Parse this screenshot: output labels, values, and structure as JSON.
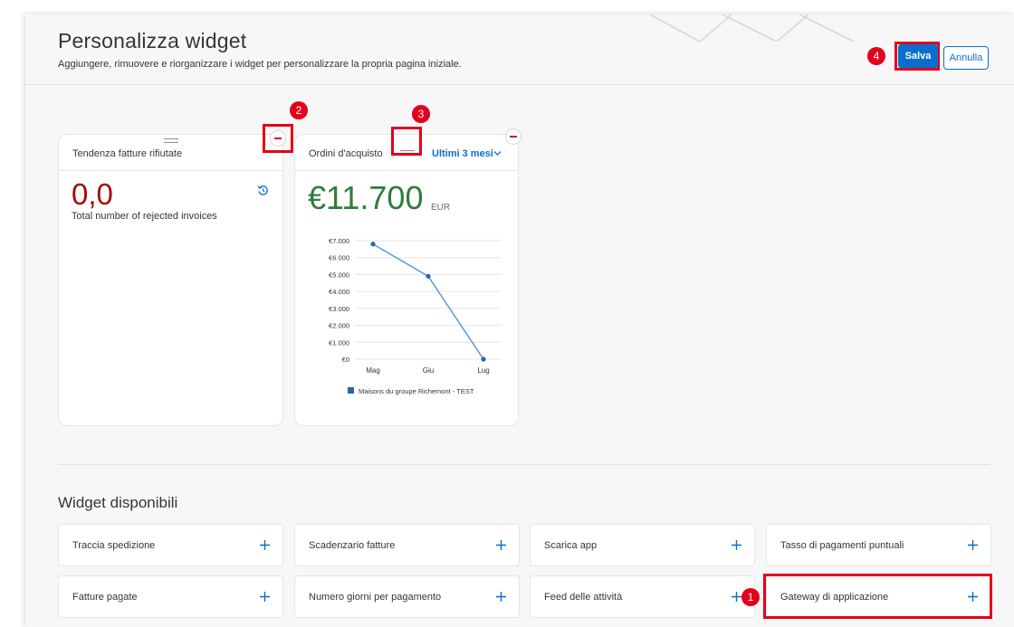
{
  "header": {
    "title": "Personalizza widget",
    "subtitle": "Aggiungere, rimuovere e riorganizzare i widget per personalizzare la propria pagina iniziale.",
    "save_label": "Salva",
    "cancel_label": "Annulla"
  },
  "callouts": [
    "1",
    "2",
    "3",
    "4"
  ],
  "widgets": {
    "rejected": {
      "title": "Tendenza fatture rifiutate",
      "value": "0,0",
      "description": "Total number of rejected invoices",
      "icon": "refresh-icon"
    },
    "orders": {
      "title": "Ordini d'acquisto",
      "period": "Ultimi 3 mesi",
      "value": "€11.700",
      "unit": "EUR"
    }
  },
  "chart_data": {
    "type": "line",
    "categories": [
      "Mag",
      "Giu",
      "Lug"
    ],
    "series": [
      {
        "name": "Maisons du groupe Richemont - TEST",
        "values": [
          6800,
          4900,
          0
        ],
        "color": "#5b9bd5"
      }
    ],
    "yticks": [
      "€7.000",
      "€6.000",
      "€5.000",
      "€4.000",
      "€3.000",
      "€2.000",
      "€1.000",
      "€0"
    ],
    "ylim": [
      0,
      7000
    ],
    "grid": true,
    "legend": "bottom"
  },
  "available": {
    "title": "Widget disponibili",
    "items": [
      "Traccia spedizione",
      "Scadenzario fatture",
      "Scarica app",
      "Tasso di pagamenti puntuali",
      "Fatture pagate",
      "Numero giorni per pagamento",
      "Feed delle attività",
      "Gateway di applicazione"
    ]
  },
  "colors": {
    "accent": "#0a6ed1",
    "callout": "#e3001b",
    "kpi_negative": "#aa0808",
    "kpi_positive": "#2f7d3a"
  }
}
